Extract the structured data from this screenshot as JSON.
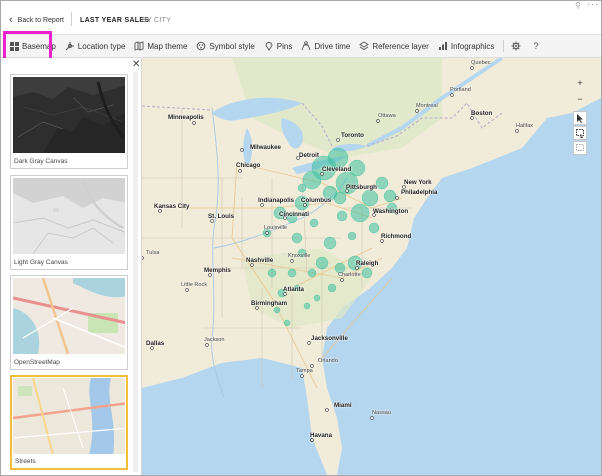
{
  "header": {
    "back_label": "Back to Report",
    "title": "LAST YEAR SALES",
    "subtitle": "BY CITY"
  },
  "toolbar": {
    "items": [
      {
        "label": "Basemap",
        "icon": "basemap-icon"
      },
      {
        "label": "Location type",
        "icon": "location-type-icon"
      },
      {
        "label": "Map theme",
        "icon": "map-theme-icon"
      },
      {
        "label": "Symbol style",
        "icon": "symbol-style-icon"
      },
      {
        "label": "Pins",
        "icon": "pin-icon"
      },
      {
        "label": "Drive time",
        "icon": "drive-time-icon"
      },
      {
        "label": "Reference layer",
        "icon": "layers-icon"
      },
      {
        "label": "Infographics",
        "icon": "infographics-icon"
      }
    ],
    "settings_icon": "gear-icon",
    "help_label": "?"
  },
  "basemap_panel": {
    "options": [
      {
        "label": "Dark Gray Canvas",
        "selected": false
      },
      {
        "label": "Light Gray Canvas",
        "selected": false
      },
      {
        "label": "OpenStreetMap",
        "selected": false
      },
      {
        "label": "Streets",
        "selected": true
      }
    ]
  },
  "map": {
    "cities": [
      "Minneapolis",
      "Milwaukee",
      "Detroit",
      "Toronto",
      "Ottawa",
      "Montreal",
      "Chicago",
      "Cleveland",
      "Pittsburgh",
      "New York",
      "Indianapolis",
      "Cincinnati",
      "Columbus",
      "Washington",
      "Philadelphia",
      "Kansas City",
      "St. Louis",
      "Louisville",
      "Richmond",
      "Nashville",
      "Knoxville",
      "Raleigh",
      "Memphis",
      "Charlotte",
      "Tulsa",
      "Little Rock",
      "Atlanta",
      "Birmingham",
      "Jackson",
      "Dallas",
      "Jacksonville",
      "Orlando",
      "Tampa",
      "Miami",
      "Havana",
      "Nassau",
      "Portland",
      "Boston",
      "Halifax",
      "Quebec"
    ],
    "accent_color": "#3cc1a0"
  },
  "map_controls": {
    "zoom_in": "+",
    "zoom_out": "−"
  }
}
